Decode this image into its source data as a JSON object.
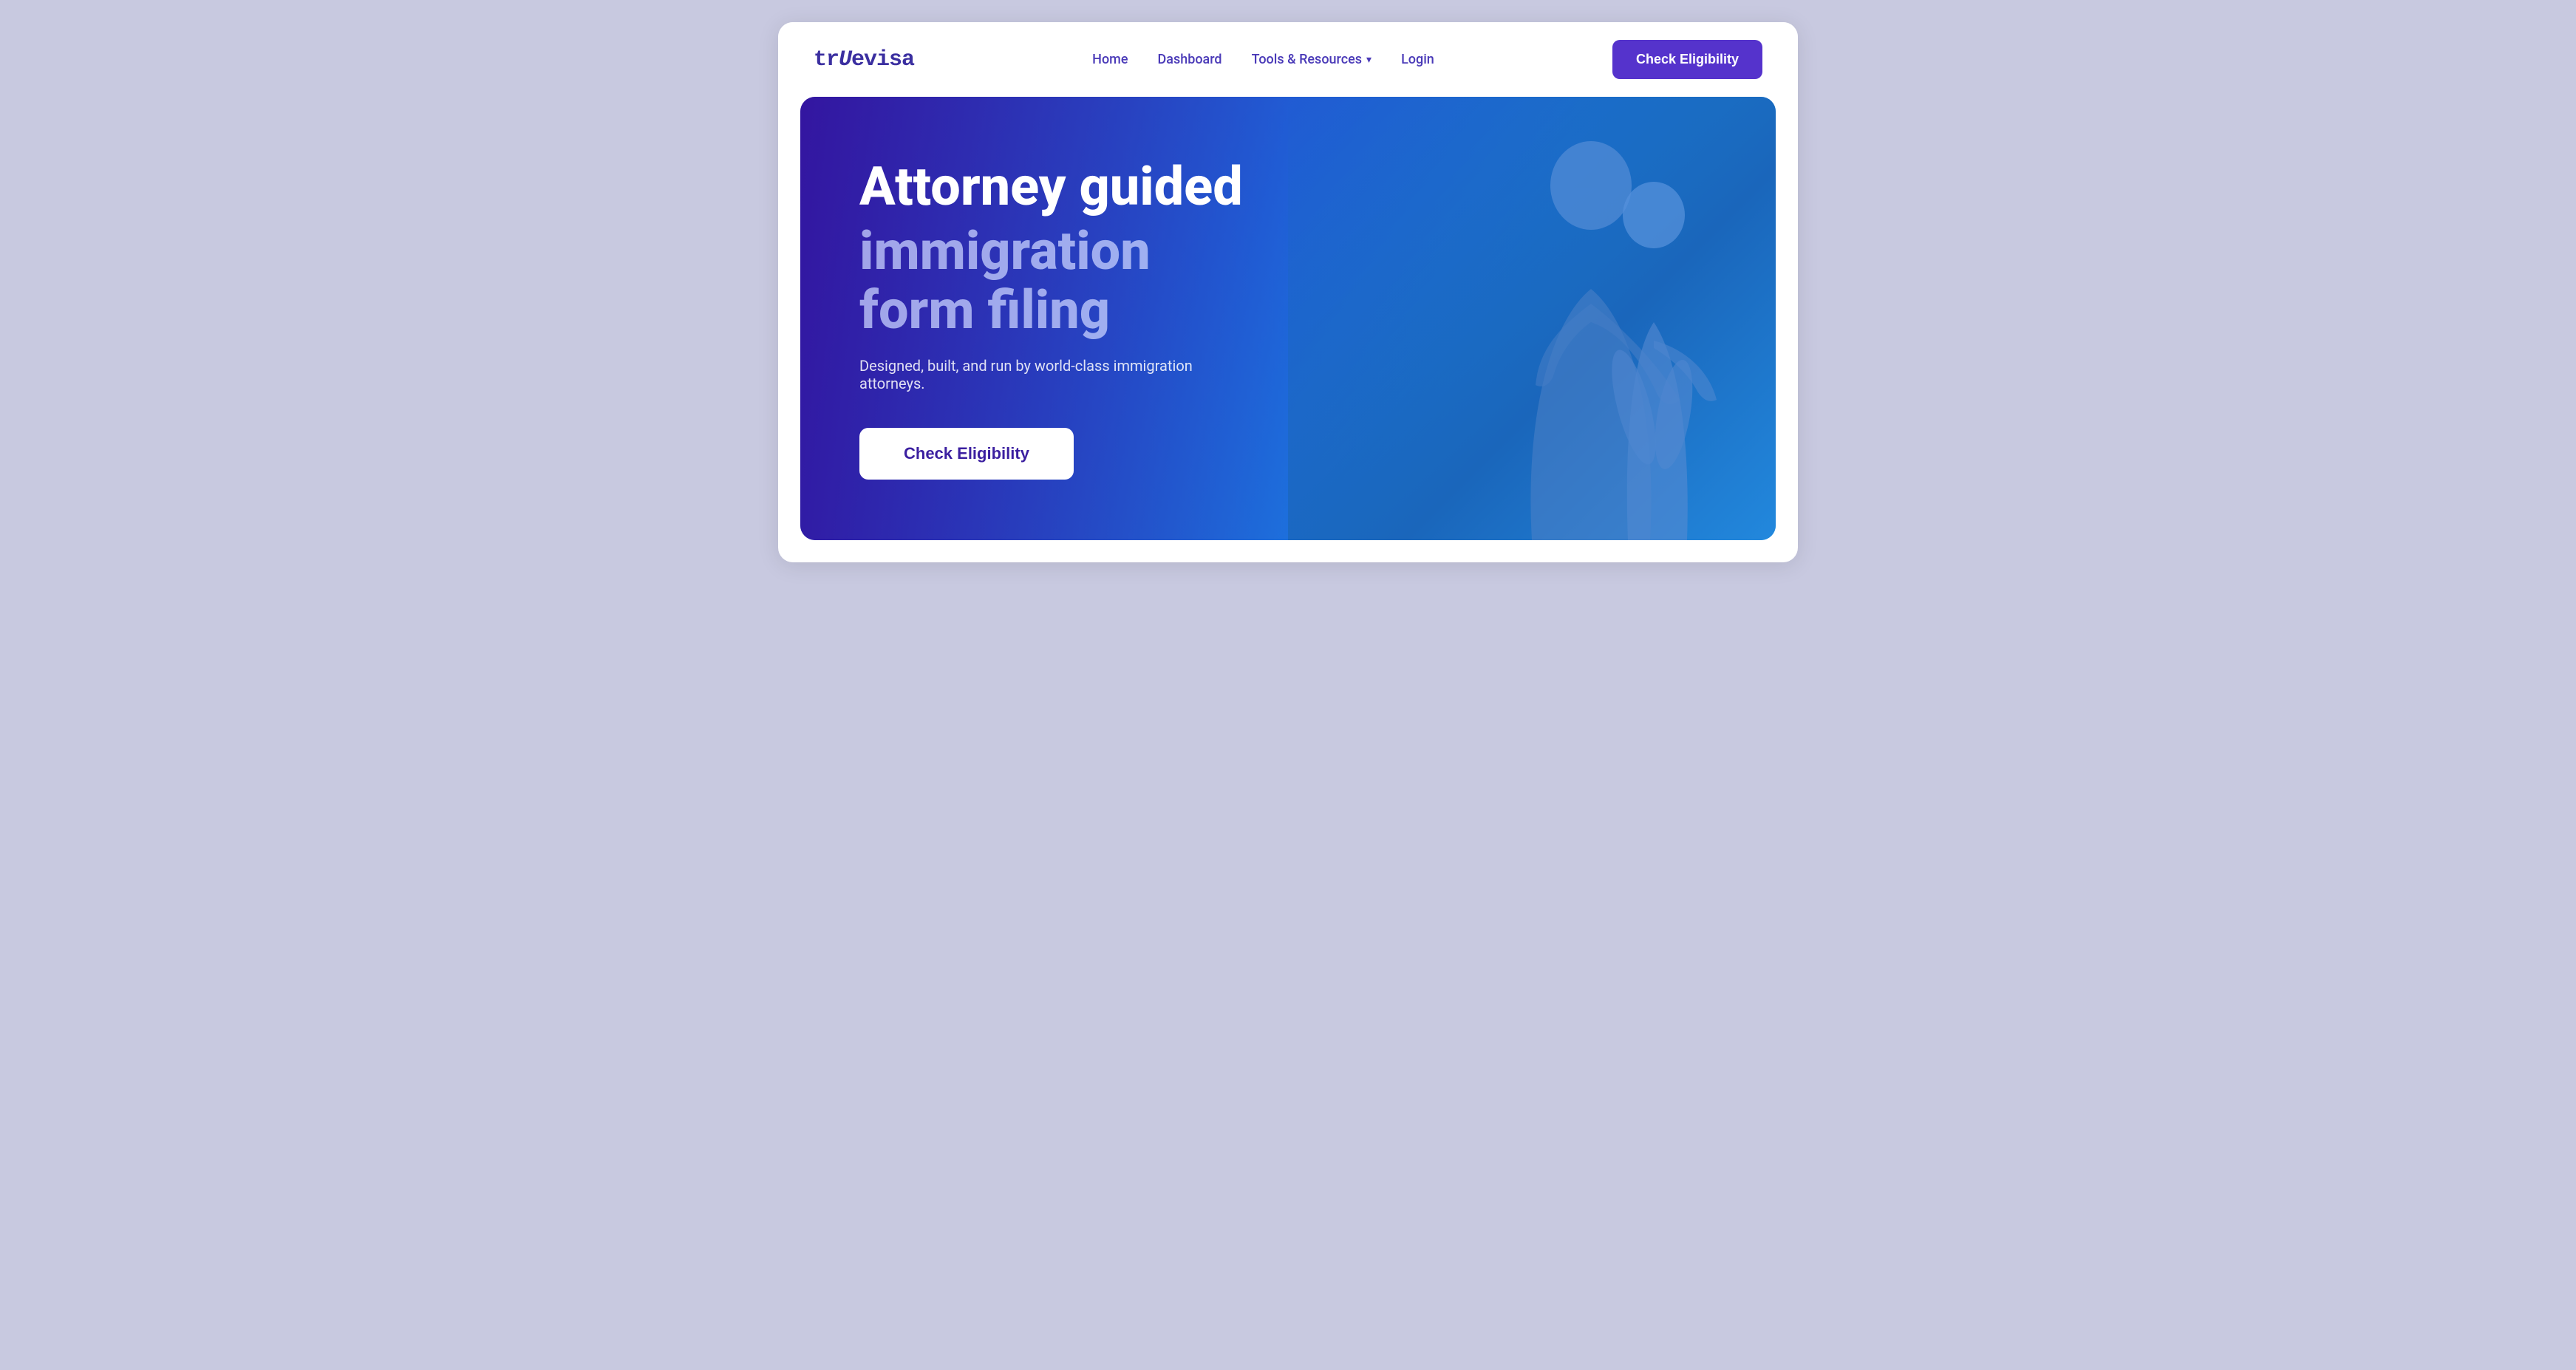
{
  "page": {
    "background_color": "#c8c9e0"
  },
  "header": {
    "logo": "TrUEVisa",
    "logo_display": "truevisa",
    "nav": {
      "items": [
        {
          "label": "Home",
          "id": "home"
        },
        {
          "label": "Dashboard",
          "id": "dashboard"
        },
        {
          "label": "Tools & Resources",
          "id": "tools-resources",
          "has_dropdown": true
        },
        {
          "label": "Login",
          "id": "login"
        }
      ]
    },
    "cta_button": "Check Eligibility"
  },
  "hero": {
    "title_line1": "Attorney guided",
    "title_line2": "immigration form filing",
    "description": "Designed, built, and run by world-class immigration attorneys.",
    "cta_button": "Check Eligibility",
    "gradient_start": "#3b1fa0",
    "gradient_mid": "#2255cc",
    "gradient_end": "#22aaee"
  }
}
